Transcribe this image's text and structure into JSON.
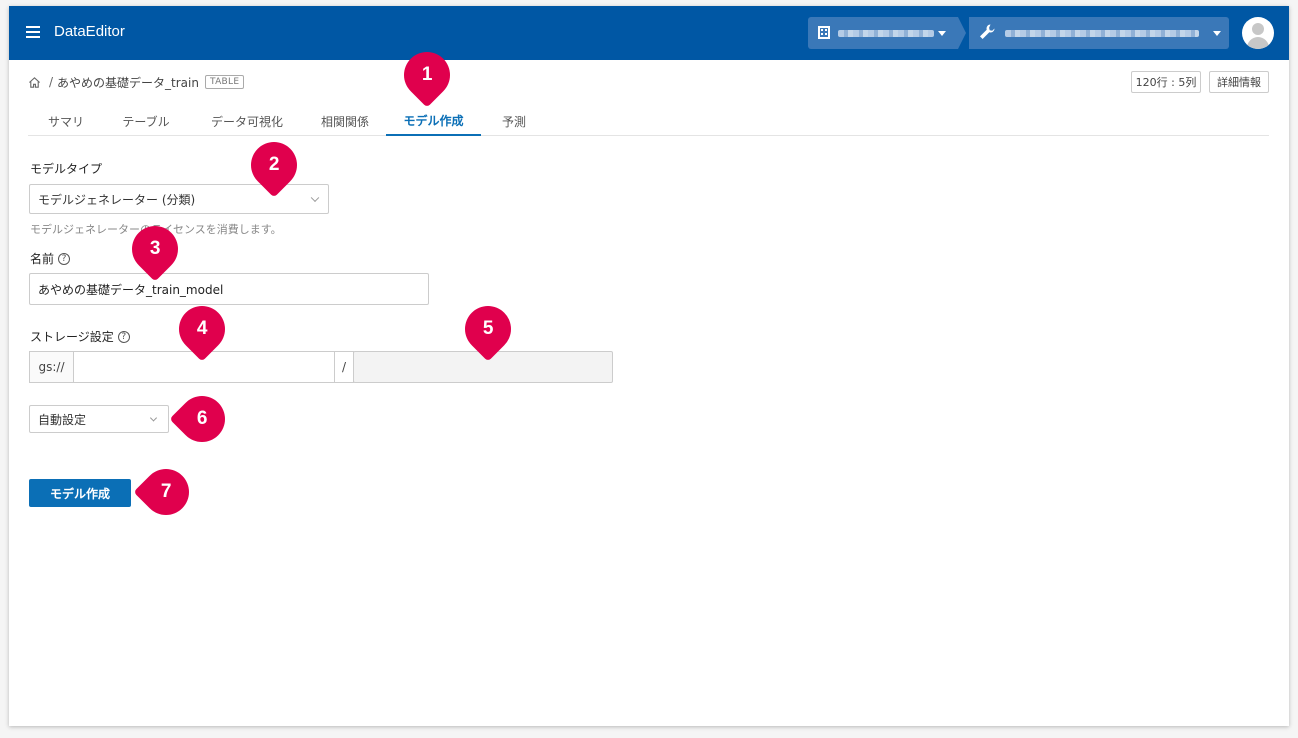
{
  "app": {
    "title": "DataEditor"
  },
  "header": {
    "org_selector": "",
    "project_selector": ""
  },
  "breadcrumb": {
    "dataset": "あやめの基礎データ_train",
    "type_badge": "TABLE"
  },
  "meta": {
    "size": "120行 : 5列",
    "details": "詳細情報"
  },
  "tabs": [
    {
      "label": "サマリ"
    },
    {
      "label": "テーブル"
    },
    {
      "label": "データ可視化"
    },
    {
      "label": "相関関係"
    },
    {
      "label": "モデル作成",
      "active": true
    },
    {
      "label": "予測"
    }
  ],
  "form": {
    "model_type": {
      "label": "モデルタイプ",
      "value": "モデルジェネレーター (分類)",
      "hint": "モデルジェネレーターのライセンスを消費します。"
    },
    "name": {
      "label": "名前",
      "value": "あやめの基礎データ_train_model"
    },
    "storage": {
      "label": "ストレージ設定",
      "prefix": "gs://",
      "bucket": "",
      "separator": "/",
      "path": ""
    },
    "mode": {
      "value": "自動設定"
    },
    "submit": {
      "label": "モデル作成"
    }
  },
  "annotations": [
    "1",
    "2",
    "3",
    "4",
    "5",
    "6",
    "7"
  ],
  "colors": {
    "appbar": "#0057a4",
    "accent": "#0b6fb6",
    "marker": "#e0004d"
  }
}
